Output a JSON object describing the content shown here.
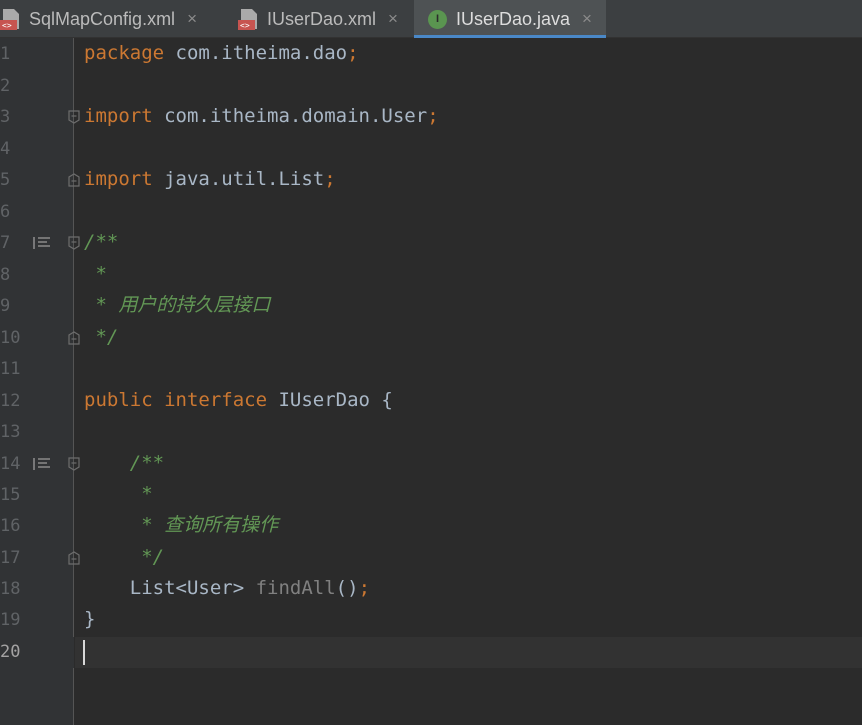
{
  "tabs": [
    {
      "label": "SqlMapConfig.xml",
      "icon": "xml-file-icon",
      "active": false
    },
    {
      "label": "IUserDao.xml",
      "icon": "xml-file-icon",
      "active": false
    },
    {
      "label": "IUserDao.java",
      "icon": "java-interface-icon",
      "active": true,
      "icon_letter": "I"
    }
  ],
  "close_glyph": "×",
  "colors": {
    "keyword": "#cc7832",
    "plain": "#a9b7c6",
    "comment": "#629755",
    "accent": "#4a88c7"
  },
  "editor": {
    "current_line": 20,
    "lines": [
      {
        "n": "1",
        "a": "package",
        "b": " com.itheima.dao",
        "c": ";"
      },
      {
        "n": "2"
      },
      {
        "n": "3",
        "a": "import",
        "b": " com.itheima.domain.User",
        "c": ";"
      },
      {
        "n": "4"
      },
      {
        "n": "5",
        "a": "import",
        "b": " java.util.List",
        "c": ";"
      },
      {
        "n": "6"
      },
      {
        "n": "7",
        "cm": "/**"
      },
      {
        "n": "8",
        "cm": " *"
      },
      {
        "n": "9",
        "cm": " * 用户的持久层接口"
      },
      {
        "n": "10",
        "cm": " */"
      },
      {
        "n": "11"
      },
      {
        "n": "12",
        "a": "public",
        "a2": "interface",
        "b": " IUserDao {"
      },
      {
        "n": "13"
      },
      {
        "n": "14",
        "cm": "    /**"
      },
      {
        "n": "15",
        "cm": "     *"
      },
      {
        "n": "16",
        "cm": "     * 查询所有操作"
      },
      {
        "n": "17",
        "cm": "     */"
      },
      {
        "n": "18",
        "b": "    List<User> ",
        "f": "findAll",
        "b2": "()",
        "c": ";"
      },
      {
        "n": "19",
        "b": "}"
      },
      {
        "n": "20"
      }
    ]
  }
}
